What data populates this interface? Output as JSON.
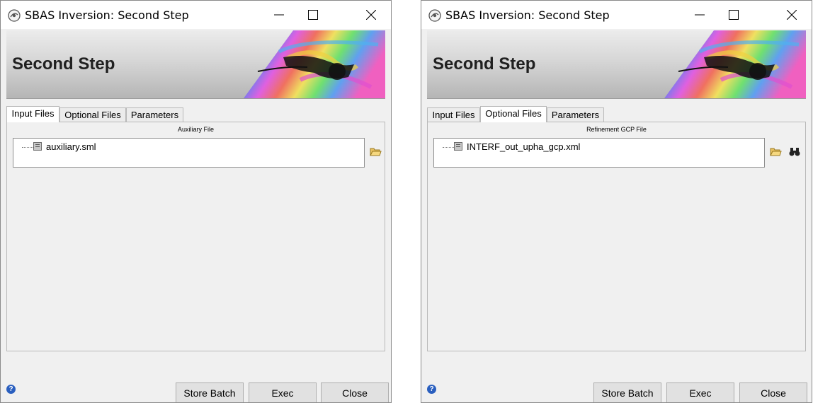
{
  "windows": [
    {
      "title": "SBAS Inversion: Second Step",
      "banner_title": "Second Step",
      "tabs": [
        {
          "label": "Input Files",
          "active": true
        },
        {
          "label": "Optional Files",
          "active": false
        },
        {
          "label": "Parameters",
          "active": false
        }
      ],
      "panel_label": "Auxiliary File",
      "file_entry": "auxiliary.sml",
      "side_icons": [
        "folder-open-icon"
      ],
      "buttons": {
        "store_batch": "Store Batch",
        "exec": "Exec",
        "close": "Close"
      }
    },
    {
      "title": "SBAS Inversion: Second Step",
      "banner_title": "Second Step",
      "tabs": [
        {
          "label": "Input Files",
          "active": false
        },
        {
          "label": "Optional Files",
          "active": true
        },
        {
          "label": "Parameters",
          "active": false
        }
      ],
      "panel_label": "Refinement GCP File",
      "file_entry": "INTERF_out_upha_gcp.xml",
      "side_icons": [
        "folder-open-icon",
        "binoculars-icon"
      ],
      "buttons": {
        "store_batch": "Store Batch",
        "exec": "Exec",
        "close": "Close"
      }
    }
  ],
  "help_glyph": "?",
  "colors": {
    "accent_help": "#2a5fbf",
    "window_bg": "#f0f0f0",
    "button_bg": "#e1e1e1"
  }
}
